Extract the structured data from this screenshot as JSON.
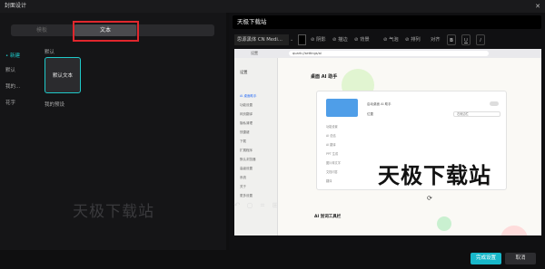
{
  "window": {
    "title": "封面设计",
    "close_glyph": "✕"
  },
  "tabs": [
    {
      "label": "模板",
      "active": false
    },
    {
      "label": "文本",
      "active": true
    }
  ],
  "categories": [
    {
      "label": "• 新建",
      "active": true
    },
    {
      "label": "默认",
      "active": false
    },
    {
      "label": "我的...",
      "active": false
    },
    {
      "label": "花字",
      "active": false
    }
  ],
  "sections": {
    "default": "默认",
    "my_presets": "我的预设"
  },
  "template_card": {
    "label": "默认文本"
  },
  "text_input": {
    "value": "天极下载站"
  },
  "toolbar": {
    "font": "思源黑体 CN Medi...",
    "color": "#000000",
    "buttons": [
      "⊘ 阴影",
      "⊘ 描边",
      "⊘ 背景",
      "⊘ 气泡",
      "⊘ 排列",
      "对齐"
    ],
    "styles": [
      "B",
      "U",
      "I"
    ]
  },
  "preview": {
    "tab_title": "设置",
    "url": "quark://settings/ai",
    "sidebar": [
      "设置",
      "AI 桌面助手",
      "功能设置",
      "网页翻译",
      "隐私清理",
      "快捷键",
      "下载",
      "扩展程序",
      "默认浏览器",
      "高级设置",
      "系统",
      "关于",
      "更多设置"
    ],
    "page_title": "桌面 AI 助手",
    "option_label": "启动桌面 AI 助手",
    "position_label": "位置",
    "position_value": "右侧边栏",
    "rows": [
      "功能设置",
      "AI 总结",
      "AI 翻译",
      "PPT 生成",
      "图片转文字",
      "文档问答",
      "翻译",
      "万能格式转换"
    ],
    "section2": "AI 划词工具栏",
    "watermark": "天极下载站"
  },
  "player_controls": [
    "↶",
    "○",
    "⌗",
    "⊞"
  ],
  "left_watermark": "天极下载站",
  "footer": {
    "confirm": "完成设置",
    "cancel": "取消"
  },
  "colors": {
    "accent": "#1fc9c9",
    "confirm_bg": "#18b7c9",
    "highlight_box": "#e0272d"
  }
}
